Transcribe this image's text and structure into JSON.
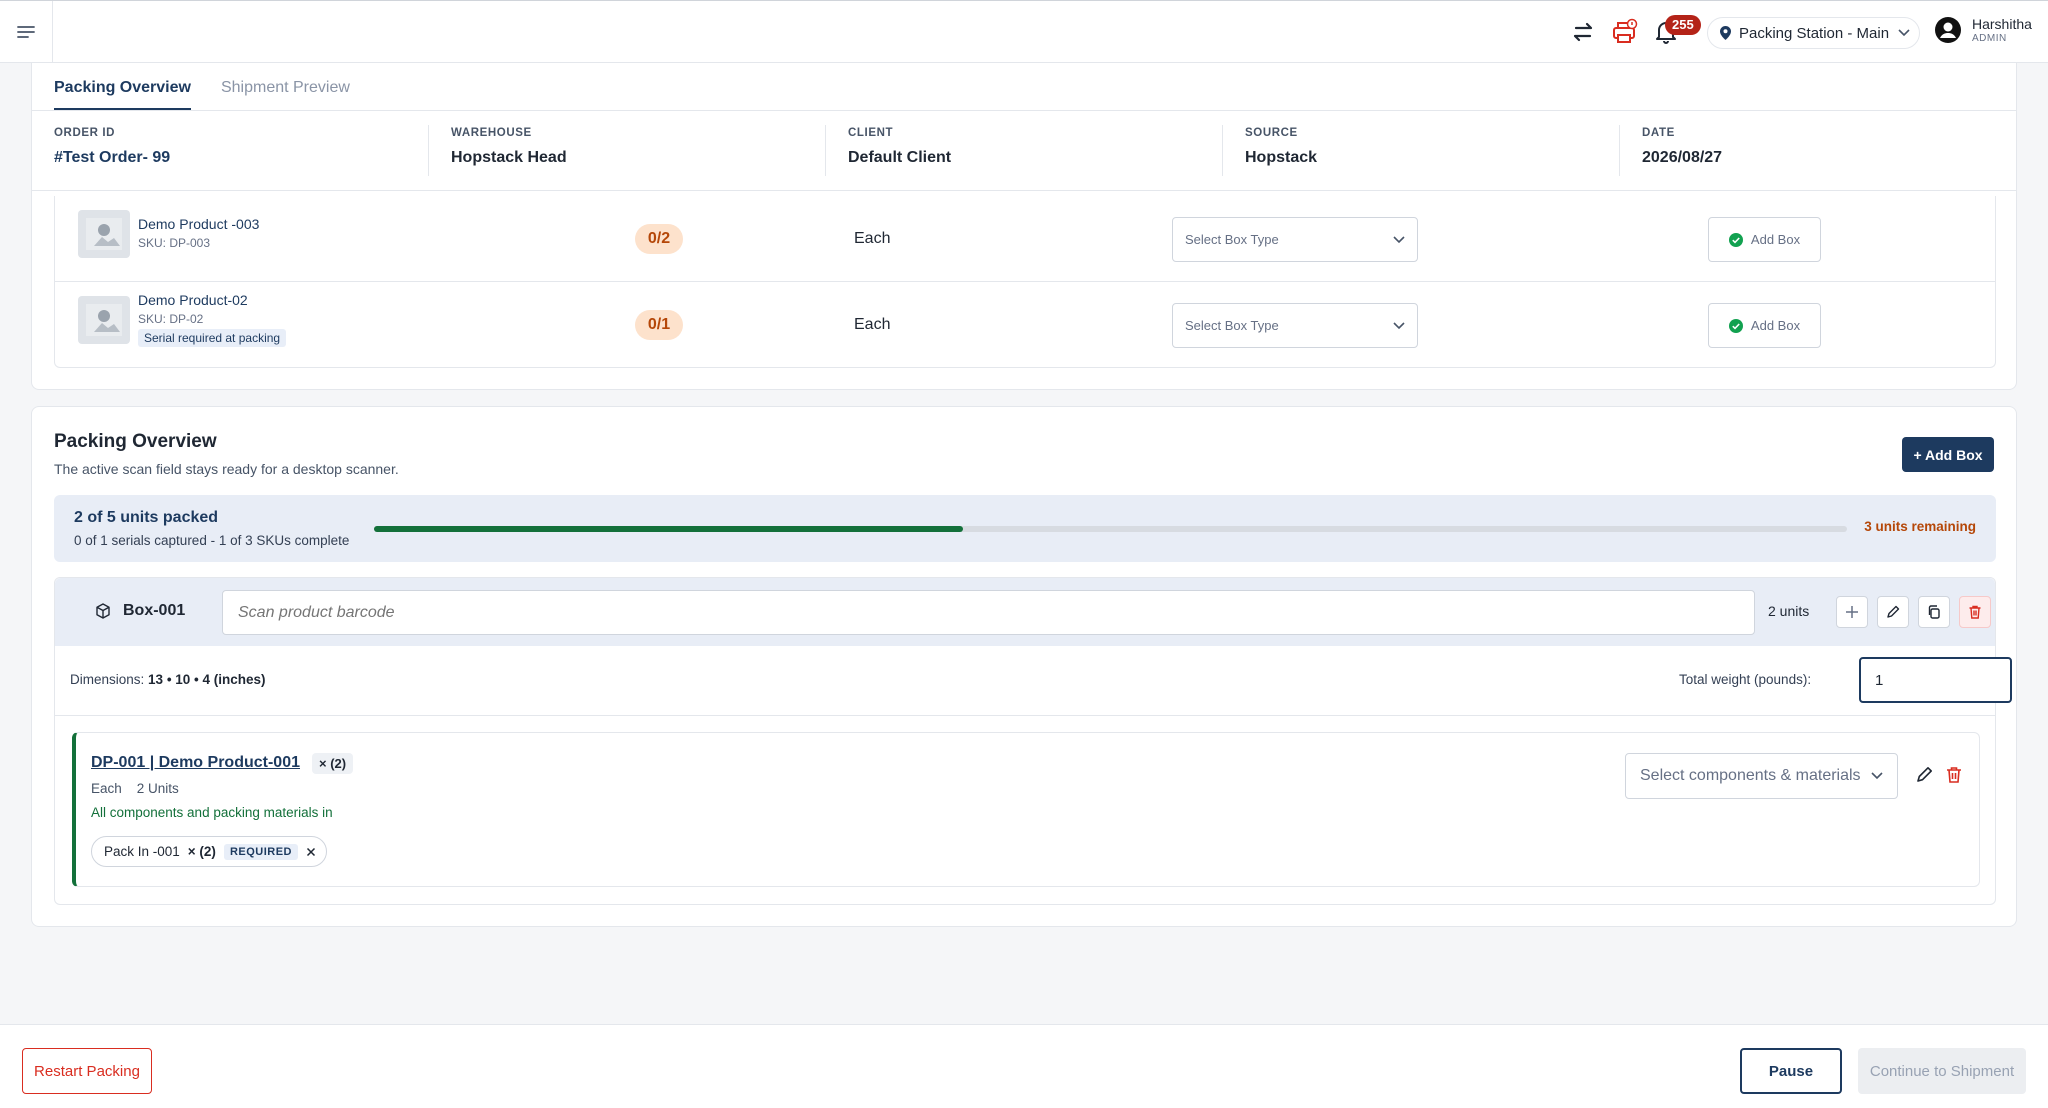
{
  "header": {
    "notification_count": "255",
    "station": "Packing Station - Main",
    "user_name": "Harshitha",
    "user_role": "ADMIN"
  },
  "tabs": [
    {
      "label": "Packing Overview",
      "active": true
    },
    {
      "label": "Shipment Preview",
      "active": false
    }
  ],
  "order_info": [
    {
      "label": "ORDER ID",
      "value": "#Test Order- 99"
    },
    {
      "label": "WAREHOUSE",
      "value": "Hopstack Head"
    },
    {
      "label": "CLIENT",
      "value": "Default Client"
    },
    {
      "label": "SOURCE",
      "value": "Hopstack"
    },
    {
      "label": "DATE",
      "value": "2026/08/27"
    }
  ],
  "products": [
    {
      "name": "Demo Product -003",
      "sku": "SKU: DP-003",
      "qty": "0/2",
      "uom": "Each",
      "box_placeholder": "Select Box Type",
      "add_label": "Add Box"
    },
    {
      "name": "Demo Product-02",
      "sku": "SKU: DP-02",
      "tag": "Serial required at packing",
      "qty": "0/1",
      "uom": "Each",
      "box_placeholder": "Select Box Type",
      "add_label": "Add Box"
    }
  ],
  "packing": {
    "title": "Packing Overview",
    "subtitle": "The active scan field stays ready for a desktop scanner.",
    "add_box_label": "+ Add Box",
    "progress_title": "2 of 5 units packed",
    "progress_sub": "0 of 1 serials captured - 1 of 3 SKUs complete",
    "progress_fraction": 0.4,
    "remaining": "3 units remaining"
  },
  "box": {
    "name": "Box-001",
    "scan_placeholder": "Scan product barcode",
    "units": "2 units",
    "dims_label": "Dimensions:",
    "dims_value": "13 • 10 • 4 (inches)",
    "weight_label": "Total weight (pounds):",
    "weight_value": "1"
  },
  "item": {
    "title": "DP-001 | Demo Product-001",
    "qty": "× (2)",
    "uom": "Each",
    "units": "2 Units",
    "status": "All components and packing materials in",
    "components_placeholder": "Select components & materials",
    "chip": {
      "name": "Pack In -001",
      "qty": "× (2)",
      "tag": "REQUIRED"
    }
  },
  "footer": {
    "restart": "Restart Packing",
    "pause": "Pause",
    "continue": "Continue to Shipment"
  },
  "colors": {
    "primary": "#1d3a5f",
    "success": "#13703a",
    "danger": "#d92d20",
    "warning": "#b54708"
  }
}
